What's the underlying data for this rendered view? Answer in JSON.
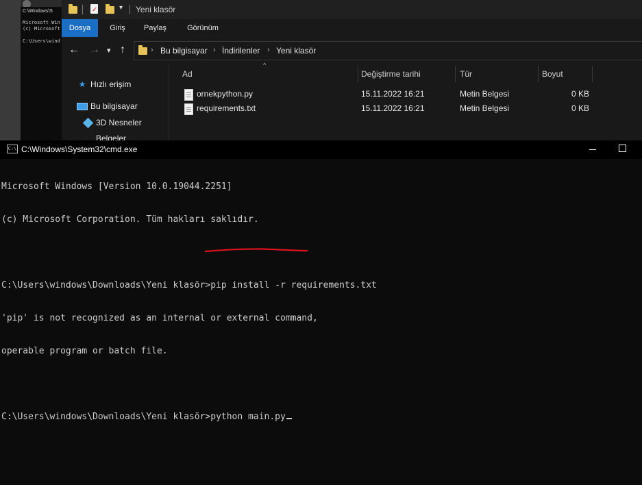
{
  "background_cmd": {
    "title": "C:\\Windows\\S",
    "lines": [
      "Microsoft Win",
      "(c) Microsoft",
      "",
      "C:\\Users\\wind"
    ]
  },
  "explorer": {
    "window_title": "Yeni klasör",
    "ribbon_tabs": [
      "Dosya",
      "Giriş",
      "Paylaş",
      "Görünüm"
    ],
    "breadcrumb": [
      "Bu bilgisayar",
      "İndirilenler",
      "Yeni klasör"
    ],
    "nav_pane": {
      "quick_access": "Hızlı erişim",
      "this_pc": "Bu bilgisayar",
      "objects_3d": "3D Nesneler",
      "partial_item": "Belgeler"
    },
    "columns": {
      "name": "Ad",
      "modified": "Değiştirme tarihi",
      "type": "Tür",
      "size": "Boyut"
    },
    "files": [
      {
        "name": "ornekpython.py",
        "modified": "15.11.2022 16:21",
        "type": "Metin Belgesi",
        "size": "0 KB"
      },
      {
        "name": "requirements.txt",
        "modified": "15.11.2022 16:21",
        "type": "Metin Belgesi",
        "size": "0 KB"
      }
    ]
  },
  "cmd": {
    "title": "C:\\Windows\\System32\\cmd.exe",
    "icon_text": "C:\\",
    "lines": [
      "Microsoft Windows [Version 10.0.19044.2251]",
      "(c) Microsoft Corporation. Tüm hakları saklıdır.",
      "",
      "C:\\Users\\windows\\Downloads\\Yeni klasör>pip install -r requirements.txt",
      "'pip' is not recognized as an internal or external command,",
      "operable program or batch file.",
      ""
    ],
    "prompt": "C:\\Users\\windows\\Downloads\\Yeni klasör>",
    "current_input": "python main.py",
    "annotation_color": "#e0121b"
  }
}
